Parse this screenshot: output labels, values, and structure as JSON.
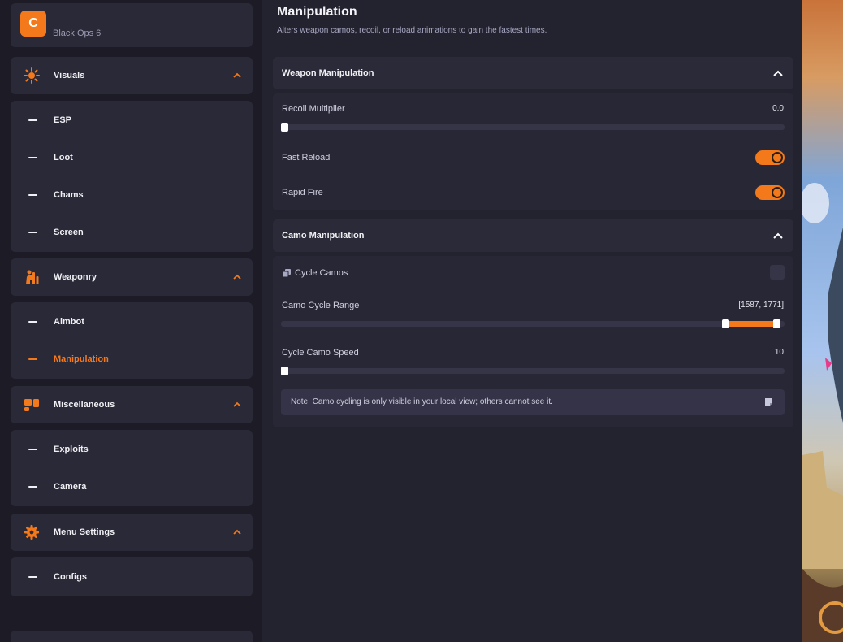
{
  "brand": {
    "logo_letter": "C",
    "name": "Black Ops 6"
  },
  "colors": {
    "accent": "#f4791b",
    "sidebar_bg": "#1d1c26",
    "panel_bg": "#2a2937",
    "main_bg": "#23232f"
  },
  "sidebar": {
    "categories": [
      {
        "label": "Visuals",
        "icon": "visuals-icon",
        "items": [
          {
            "label": "ESP"
          },
          {
            "label": "Loot"
          },
          {
            "label": "Chams"
          },
          {
            "label": "Screen"
          }
        ]
      },
      {
        "label": "Weaponry",
        "icon": "weaponry-icon",
        "items": [
          {
            "label": "Aimbot"
          },
          {
            "label": "Manipulation",
            "active": true
          }
        ]
      },
      {
        "label": "Miscellaneous",
        "icon": "miscellaneous-icon",
        "items": [
          {
            "label": "Exploits"
          },
          {
            "label": "Camera"
          }
        ]
      },
      {
        "label": "Menu Settings",
        "icon": "gear-icon",
        "items": [
          {
            "label": "Configs"
          }
        ]
      }
    ]
  },
  "main": {
    "title": "Manipulation",
    "description": "Alters weapon camos, recoil, or reload animations to gain the fastest times.",
    "weapon_section": {
      "title": "Weapon Manipulation",
      "recoil": {
        "label": "Recoil Multiplier",
        "value": "0.0",
        "fraction": 0.0
      },
      "fast_reload": {
        "label": "Fast Reload",
        "enabled": true
      },
      "rapid_fire": {
        "label": "Rapid Fire",
        "enabled": true
      }
    },
    "camo_section": {
      "title": "Camo Manipulation",
      "cycle_camos": {
        "label": "Cycle Camos",
        "checked": false
      },
      "cycle_range": {
        "label": "Camo Cycle Range",
        "value": "[1587, 1771]",
        "low_fraction": 0.888,
        "high_fraction": 0.992
      },
      "cycle_speed": {
        "label": "Cycle Camo Speed",
        "value": "10",
        "fraction": 0.0
      },
      "note": "Note: Camo cycling is only visible in your local view; others cannot see it."
    }
  }
}
